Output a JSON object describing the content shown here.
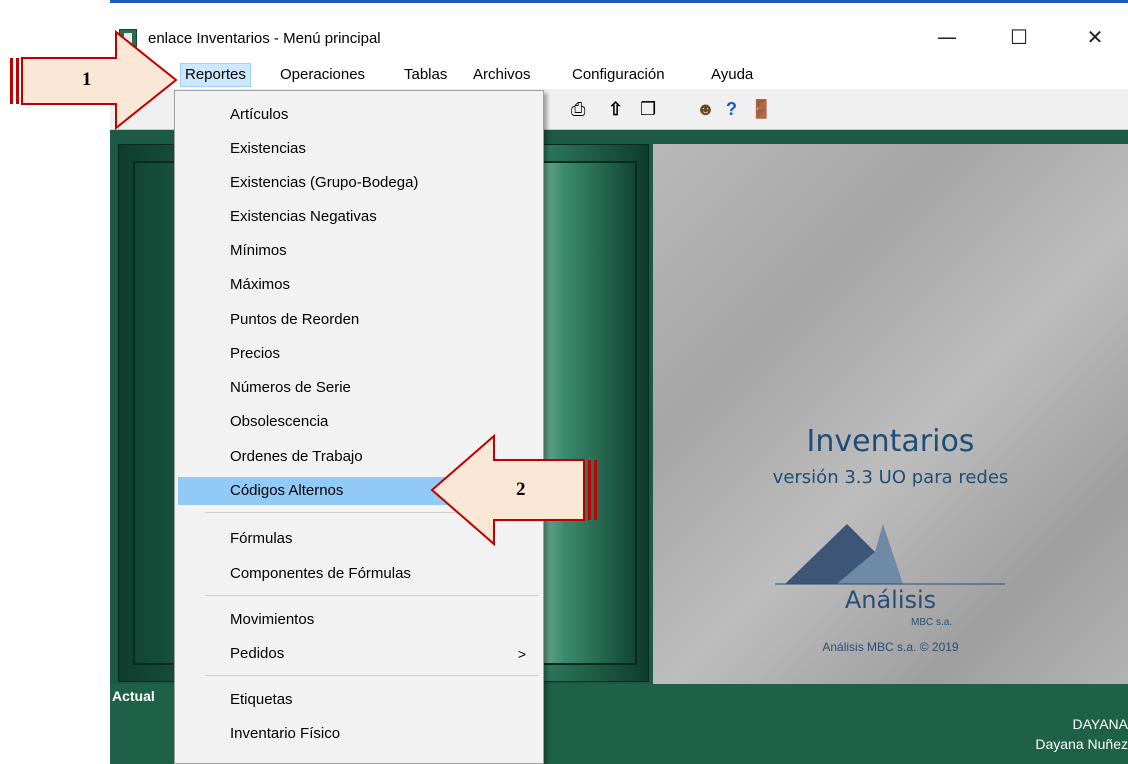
{
  "window": {
    "title": "enlace Inventarios - Menú principal",
    "controls": {
      "minimize": "—",
      "maximize": "☐",
      "close": "✕"
    }
  },
  "menubar": {
    "items": [
      "Reportes",
      "Operaciones",
      "Tablas",
      "Archivos",
      "Configuración",
      "Ayuda"
    ],
    "active": "Reportes"
  },
  "toolbar": {
    "icons": [
      "edit-icon",
      "printer-icon",
      "up-arrow-icon",
      "windows-icon",
      "users-icon",
      "help-icon",
      "exit-door-icon"
    ]
  },
  "dropdown": {
    "items": [
      "Artículos",
      "Existencias",
      "Existencias (Grupo-Bodega)",
      "Existencias Negativas",
      "Mínimos",
      "Máximos",
      "Puntos de Reorden",
      "Precios",
      "Números de Serie",
      "Obsolescencia",
      "Ordenes de Trabajo",
      "Códigos Alternos",
      "Fórmulas",
      "Componentes de Fórmulas",
      "Movimientos",
      "Pedidos",
      "Etiquetas",
      "Inventario Físico"
    ],
    "highlighted": "Códigos Alternos",
    "submenu_indicator": ">"
  },
  "splash": {
    "title": "Inventarios",
    "version": "versión 3.3 UO para redes",
    "logo_name": "Análisis",
    "logo_sub": "MBC s.a.",
    "copyright": "Análisis MBC s.a. © 2019"
  },
  "statusbar": {
    "label": "Actual",
    "user_code": "DAYANA",
    "user_name": "Dayana Nuñez"
  },
  "annotations": {
    "arrow1": "1",
    "arrow2": "2"
  },
  "colors": {
    "highlight": "#91c9f7",
    "desk": "#1c5a45",
    "arrow_fill": "#fbe7d6",
    "arrow_stroke": "#c00000"
  }
}
